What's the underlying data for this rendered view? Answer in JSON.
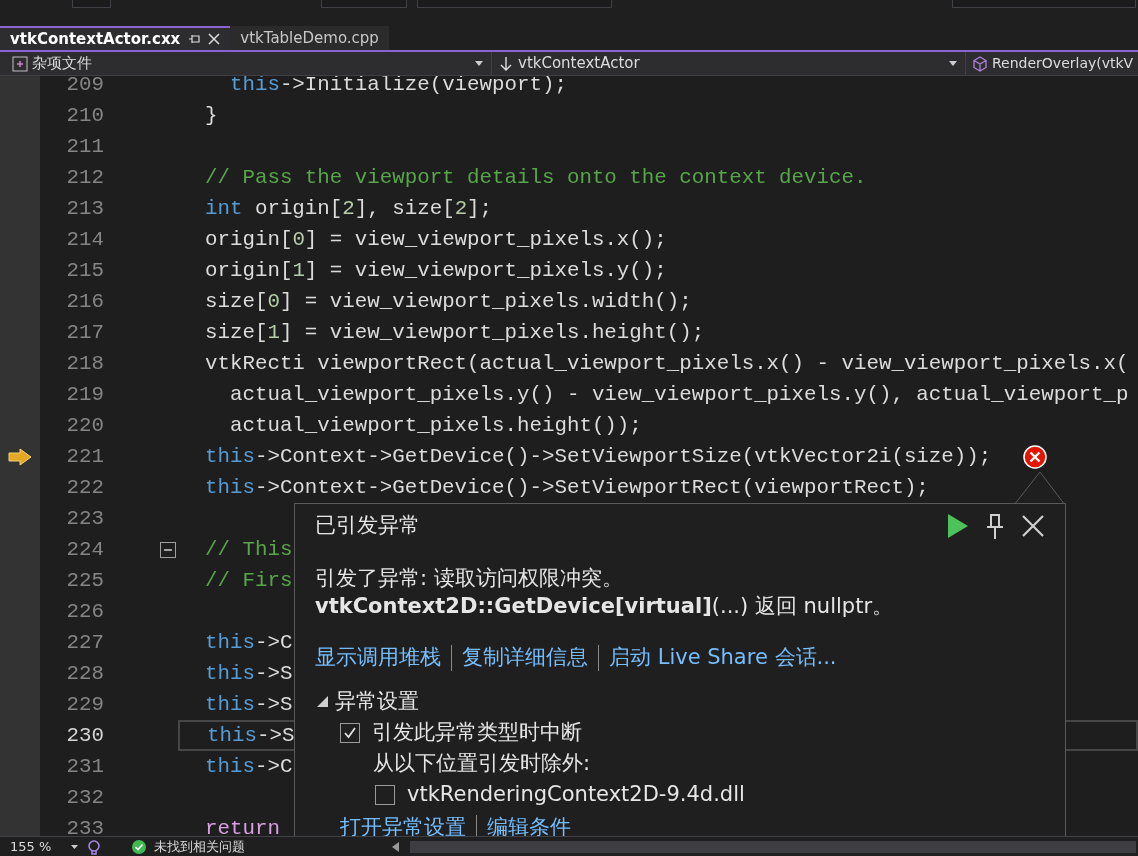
{
  "tabs": [
    {
      "label": "vtkContextActor.cxx",
      "selected": true
    },
    {
      "label": "vtkTableDemo.cpp",
      "selected": false
    }
  ],
  "nav_bar": {
    "project": "杂项文件",
    "scope": "vtkContextActor",
    "member": "RenderOverlay(vtkV"
  },
  "editor": {
    "lines": [
      {
        "number": "209",
        "executing": false,
        "current": false,
        "fold_toggle": false,
        "error": false,
        "tokens": [
          {
            "text": "  this",
            "kind": "keyword"
          },
          {
            "text": "->Initialize(viewport);",
            "kind": "plain"
          }
        ]
      },
      {
        "number": "210",
        "executing": false,
        "current": false,
        "fold_toggle": false,
        "error": false,
        "tokens": [
          {
            "text": "}",
            "kind": "plain"
          }
        ]
      },
      {
        "number": "211",
        "executing": false,
        "current": false,
        "fold_toggle": false,
        "error": false
      },
      {
        "number": "212",
        "executing": false,
        "current": false,
        "fold_toggle": false,
        "error": false,
        "tokens": [
          {
            "text": "// Pass the viewport details onto the context device.",
            "kind": "comment"
          }
        ]
      },
      {
        "number": "213",
        "executing": false,
        "current": false,
        "fold_toggle": false,
        "error": false,
        "tokens": [
          {
            "text": "int",
            "kind": "keyword"
          },
          {
            "text": " origin[",
            "kind": "plain"
          },
          {
            "text": "2",
            "kind": "number"
          },
          {
            "text": "], size[",
            "kind": "plain"
          },
          {
            "text": "2",
            "kind": "number"
          },
          {
            "text": "];",
            "kind": "plain"
          }
        ]
      },
      {
        "number": "214",
        "executing": false,
        "current": false,
        "fold_toggle": false,
        "error": false,
        "tokens": [
          {
            "text": "origin[",
            "kind": "plain"
          },
          {
            "text": "0",
            "kind": "number"
          },
          {
            "text": "] = view_viewport_pixels.x();",
            "kind": "plain"
          }
        ]
      },
      {
        "number": "215",
        "executing": false,
        "current": false,
        "fold_toggle": false,
        "error": false,
        "tokens": [
          {
            "text": "origin[",
            "kind": "plain"
          },
          {
            "text": "1",
            "kind": "number"
          },
          {
            "text": "] = view_viewport_pixels.y();",
            "kind": "plain"
          }
        ]
      },
      {
        "number": "216",
        "executing": false,
        "current": false,
        "fold_toggle": false,
        "error": false,
        "tokens": [
          {
            "text": "size[",
            "kind": "plain"
          },
          {
            "text": "0",
            "kind": "number"
          },
          {
            "text": "] = view_viewport_pixels.width();",
            "kind": "plain"
          }
        ]
      },
      {
        "number": "217",
        "executing": false,
        "current": false,
        "fold_toggle": false,
        "error": false,
        "tokens": [
          {
            "text": "size[",
            "kind": "plain"
          },
          {
            "text": "1",
            "kind": "number"
          },
          {
            "text": "] = view_viewport_pixels.height();",
            "kind": "plain"
          }
        ]
      },
      {
        "number": "218",
        "executing": false,
        "current": false,
        "fold_toggle": false,
        "error": false,
        "tokens": [
          {
            "text": "vtkRecti viewportRect(actual_viewport_pixels.x() - view_viewport_pixels.x(",
            "kind": "plain"
          }
        ]
      },
      {
        "number": "219",
        "executing": false,
        "current": false,
        "fold_toggle": false,
        "error": false,
        "tokens": [
          {
            "text": "  actual_viewport_pixels.y() - view_viewport_pixels.y(), actual_viewport_p",
            "kind": "plain"
          }
        ]
      },
      {
        "number": "220",
        "executing": false,
        "current": false,
        "fold_toggle": false,
        "error": false,
        "tokens": [
          {
            "text": "  actual_viewport_pixels.height());",
            "kind": "plain"
          }
        ]
      },
      {
        "number": "221",
        "executing": true,
        "current": false,
        "fold_toggle": false,
        "error": true,
        "tokens": [
          {
            "text": "this",
            "kind": "keyword"
          },
          {
            "text": "->Context->GetDevice()->SetViewportSize(vtkVector2i(size));",
            "kind": "plain"
          }
        ]
      },
      {
        "number": "222",
        "executing": false,
        "current": false,
        "fold_toggle": false,
        "error": false,
        "tokens": [
          {
            "text": "this",
            "kind": "keyword"
          },
          {
            "text": "->Context->GetDevice()->SetViewportRect(viewportRect);",
            "kind": "plain"
          }
        ]
      },
      {
        "number": "223",
        "executing": false,
        "current": false,
        "fold_toggle": false,
        "error": false
      },
      {
        "number": "224",
        "executing": false,
        "current": false,
        "fold_toggle": true,
        "error": false,
        "tokens": [
          {
            "text": "// This",
            "kind": "comment"
          }
        ]
      },
      {
        "number": "225",
        "executing": false,
        "current": false,
        "fold_toggle": false,
        "error": false,
        "tokens": [
          {
            "text": "// Firs",
            "kind": "comment"
          }
        ]
      },
      {
        "number": "226",
        "executing": false,
        "current": false,
        "fold_toggle": false,
        "error": false
      },
      {
        "number": "227",
        "executing": false,
        "current": false,
        "fold_toggle": false,
        "error": false,
        "tokens": [
          {
            "text": "this",
            "kind": "keyword"
          },
          {
            "text": "->C",
            "kind": "plain"
          }
        ]
      },
      {
        "number": "228",
        "executing": false,
        "current": false,
        "fold_toggle": false,
        "error": false,
        "tokens": [
          {
            "text": "this",
            "kind": "keyword"
          },
          {
            "text": "->S",
            "kind": "plain"
          }
        ]
      },
      {
        "number": "229",
        "executing": false,
        "current": false,
        "fold_toggle": false,
        "error": false,
        "tokens": [
          {
            "text": "this",
            "kind": "keyword"
          },
          {
            "text": "->S",
            "kind": "plain"
          }
        ]
      },
      {
        "number": "230",
        "executing": false,
        "current": true,
        "fold_toggle": false,
        "error": false,
        "tokens": [
          {
            "text": "this",
            "kind": "keyword"
          },
          {
            "text": "->S",
            "kind": "plain"
          }
        ]
      },
      {
        "number": "231",
        "executing": false,
        "current": false,
        "fold_toggle": false,
        "error": false,
        "tokens": [
          {
            "text": "this",
            "kind": "keyword"
          },
          {
            "text": "->C",
            "kind": "plain"
          }
        ]
      },
      {
        "number": "232",
        "executing": false,
        "current": false,
        "fold_toggle": false,
        "error": false
      },
      {
        "number": "233",
        "executing": false,
        "current": false,
        "fold_toggle": false,
        "error": false,
        "tokens": [
          {
            "text": "return",
            "kind": "control"
          }
        ]
      }
    ]
  },
  "exception_popup": {
    "title": "已引发异常",
    "message": [
      "引发了异常: 读取访问权限冲突。",
      "**vtkContext2D::GetDevice[virtual]**(...) 返回 nullptr。"
    ],
    "links": [
      "显示调用堆栈",
      "复制详细信息",
      "启动 Live Share 会话..."
    ],
    "settings": {
      "title": "异常设置",
      "expanded": true,
      "break_option": {
        "label": "引发此异常类型时中断",
        "checked": true
      },
      "except_label": "从以下位置引发时除外:",
      "modules": [
        {
          "label": "vtkRenderingContext2D-9.4d.dll",
          "checked": false
        }
      ]
    },
    "bottom_links": [
      "打开异常设置",
      "编辑条件"
    ]
  },
  "status_bar": {
    "zoom": "155 %",
    "issues": "未找到相关问题"
  }
}
